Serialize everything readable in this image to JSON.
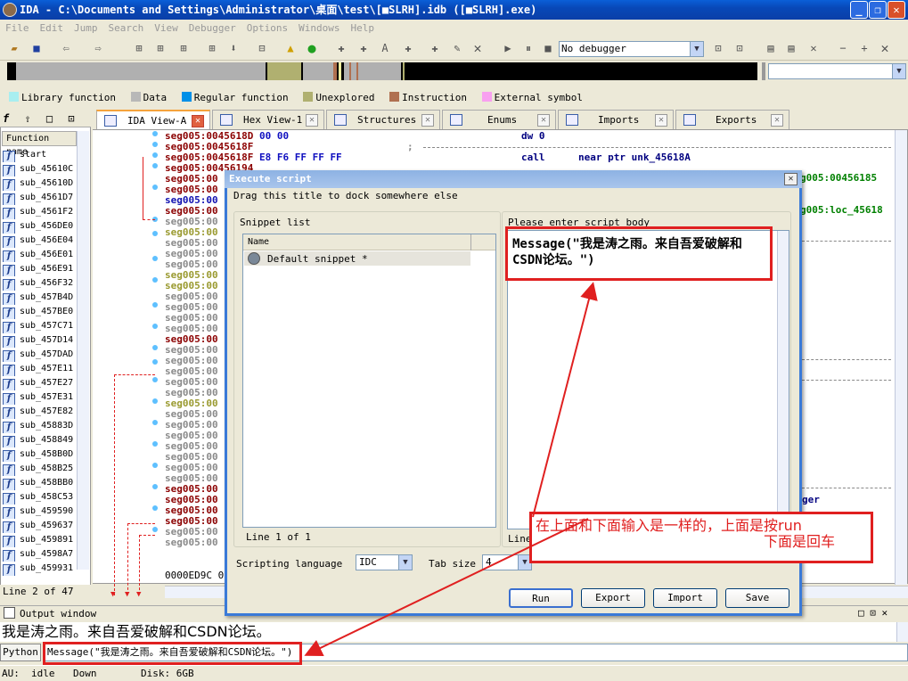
{
  "window": {
    "title": "IDA - C:\\Documents and Settings\\Administrator\\桌面\\test\\[■SLRH].idb ([■SLRH].exe)"
  },
  "menu": [
    "File",
    "Edit",
    "Jump",
    "Search",
    "View",
    "Debugger",
    "Options",
    "Windows",
    "Help"
  ],
  "toolbar": {
    "debugger_select": "No debugger"
  },
  "legend": [
    {
      "label": "Library function",
      "color": "#a8eef0"
    },
    {
      "label": "Data",
      "color": "#b8b8b8"
    },
    {
      "label": "Regular function",
      "color": "#0090e8"
    },
    {
      "label": "Unexplored",
      "color": "#b0b070"
    },
    {
      "label": "Instruction",
      "color": "#b07050"
    },
    {
      "label": "External symbol",
      "color": "#f8a0f0"
    }
  ],
  "functions": {
    "header": "Function name",
    "items": [
      "start",
      "sub_45610C",
      "sub_45610D",
      "sub_4561D7",
      "sub_4561F2",
      "sub_456DE0",
      "sub_456E04",
      "sub_456E01",
      "sub_456E91",
      "sub_456F32",
      "sub_457B4D",
      "sub_457BE0",
      "sub_457C71",
      "sub_457D14",
      "sub_457DAD",
      "sub_457E11",
      "sub_457E27",
      "sub_457E31",
      "sub_457E82",
      "sub_45883D",
      "sub_458849",
      "sub_458B0D",
      "sub_458B25",
      "sub_458BB0",
      "sub_458C53",
      "sub_459590",
      "sub_459637",
      "sub_459891",
      "sub_4598A7",
      "sub_459931"
    ],
    "status": "Line 2 of 47"
  },
  "tabs": [
    "IDA View-A",
    "Hex View-1",
    "Structures",
    "Enums",
    "Imports",
    "Exports"
  ],
  "code": {
    "row1": {
      "addr": "seg005:0045618D",
      "bytes": "00 00",
      "op": "dw 0"
    },
    "row2": {
      "addr": "seg005:0045618F",
      "bytes": "",
      "op": ";"
    },
    "row3": {
      "addr": "seg005:0045618F",
      "bytes": "E8 F6 FF FF FF",
      "op": "call",
      "args": "near ptr unk_45618A"
    },
    "row4": {
      "addr": "seg005:00456194"
    },
    "seg_prefix": "seg005:00",
    "right_ref1": "g005:00456185",
    "right_ref2": "g005:loc_45618",
    "right_ref3": "ger",
    "addr_footer": "0000ED9C 0"
  },
  "dialog": {
    "title": "Execute script",
    "drag_hint": "Drag this title to dock somewhere else",
    "snippet_label": "Snippet list",
    "col_name": "Name",
    "snippet_item": "Default snippet *",
    "snippet_status": "Line 1 of 1",
    "body_label": "Please enter script body",
    "script_body": "Message(\"我是涛之雨。来自吾爱破解和CSDN论坛。\")",
    "cursor_status": "Line 1  Column:32",
    "lang_label": "Scripting language",
    "lang_value": "IDC",
    "tab_label": "Tab size",
    "tab_value": "4",
    "buttons": {
      "run": "Run",
      "export": "Export",
      "import": "Import",
      "save": "Save"
    }
  },
  "annotation": {
    "line1": "在上面和下面输入是一样的，上面是按run",
    "line2": "下面是回车"
  },
  "output": {
    "title": "Output window",
    "text": "我是涛之雨。来自吾爱破解和CSDN论坛。"
  },
  "python": {
    "label": "Python",
    "command": "Message(\"我是涛之雨。来自吾爱破解和CSDN论坛。\")"
  },
  "status": {
    "au": "AU:",
    "state": "idle",
    "dir": "Down",
    "disk": "Disk: 6GB"
  }
}
